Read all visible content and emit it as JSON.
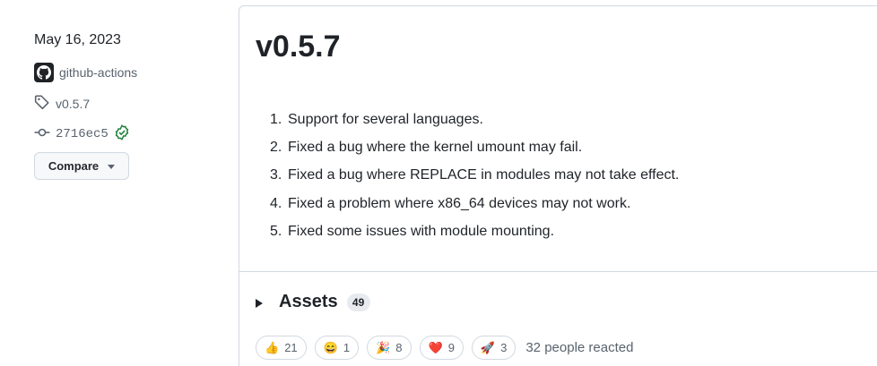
{
  "sidebar": {
    "date": "May 16, 2023",
    "author": "github-actions",
    "tag": "v0.5.7",
    "commit": "2716ec5",
    "compare_label": "Compare"
  },
  "release": {
    "title": "v0.5.7",
    "notes": [
      {
        "num": "1.",
        "text": "Support for several languages."
      },
      {
        "num": "2.",
        "text": "Fixed a bug where the kernel umount may fail."
      },
      {
        "num": "3.",
        "text": "Fixed a bug where REPLACE in modules may not take effect."
      },
      {
        "num": "4.",
        "text": "Fixed a problem where x86_64 devices may not work."
      },
      {
        "num": "5.",
        "text": "Fixed some issues with module mounting."
      }
    ],
    "assets_label": "Assets",
    "assets_count": "49",
    "reactions": [
      {
        "emoji": "👍",
        "name": "thumbs-up-icon",
        "count": "21"
      },
      {
        "emoji": "😄",
        "name": "smile-icon",
        "count": "1"
      },
      {
        "emoji": "🎉",
        "name": "party-popper-icon",
        "count": "8"
      },
      {
        "emoji": "❤️",
        "name": "heart-icon",
        "count": "9"
      },
      {
        "emoji": "🚀",
        "name": "rocket-icon",
        "count": "3"
      }
    ],
    "reacted_text": "32 people reacted"
  },
  "colors": {
    "verified_green": "#1a7f37",
    "border": "#d1d9e0",
    "muted_text": "#59636e"
  }
}
